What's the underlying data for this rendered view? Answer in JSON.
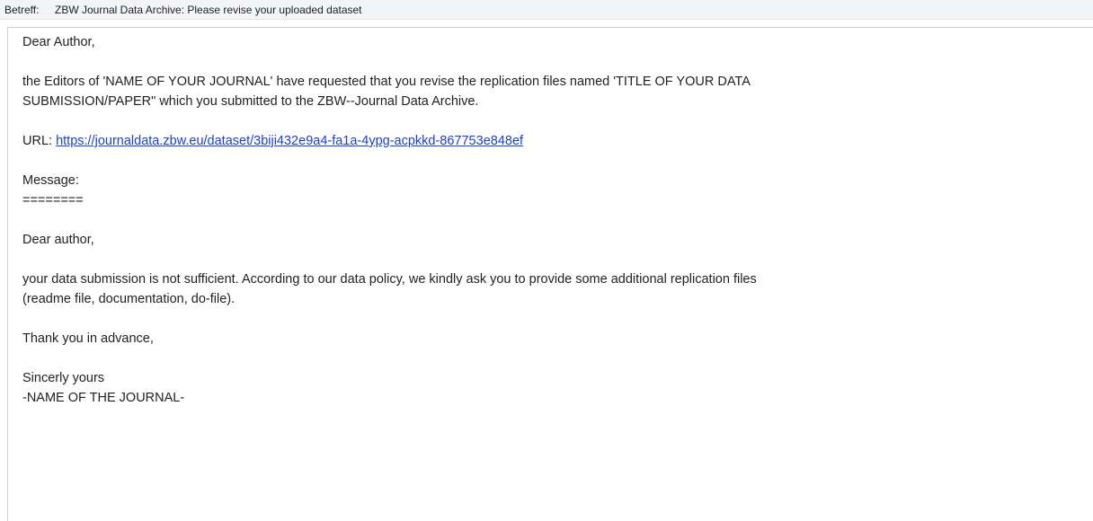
{
  "header": {
    "label": "Betreff:",
    "subject": "ZBW Journal Data Archive: Please revise your uploaded dataset"
  },
  "email": {
    "greeting": "Dear Author,",
    "intro_line1": "the Editors of 'NAME OF YOUR JOURNAL' have requested that you revise the replication files named 'TITLE OF YOUR DATA",
    "intro_line2": "SUBMISSION/PAPER\" which you submitted to the ZBW--Journal Data Archive.",
    "url_label": "URL: ",
    "url": "https://journaldata.zbw.eu/dataset/3biji432e9a4-fa1a-4ypg-acpkkd-867753e848ef",
    "message_label": "Message:",
    "separator": "========",
    "inner_greeting": "Dear author,",
    "body_line1": "your data submission is not sufficient. According to our data policy, we kindly ask you to provide some additional replication files",
    "body_line2": "(readme file, documentation, do-file).",
    "thanks": "Thank you in advance,",
    "closing": "Sincerly yours",
    "signature": "-NAME OF THE JOURNAL-"
  },
  "colors": {
    "header_bg": "#f3f4f6",
    "link": "#1a3fd6",
    "text": "#222222"
  }
}
